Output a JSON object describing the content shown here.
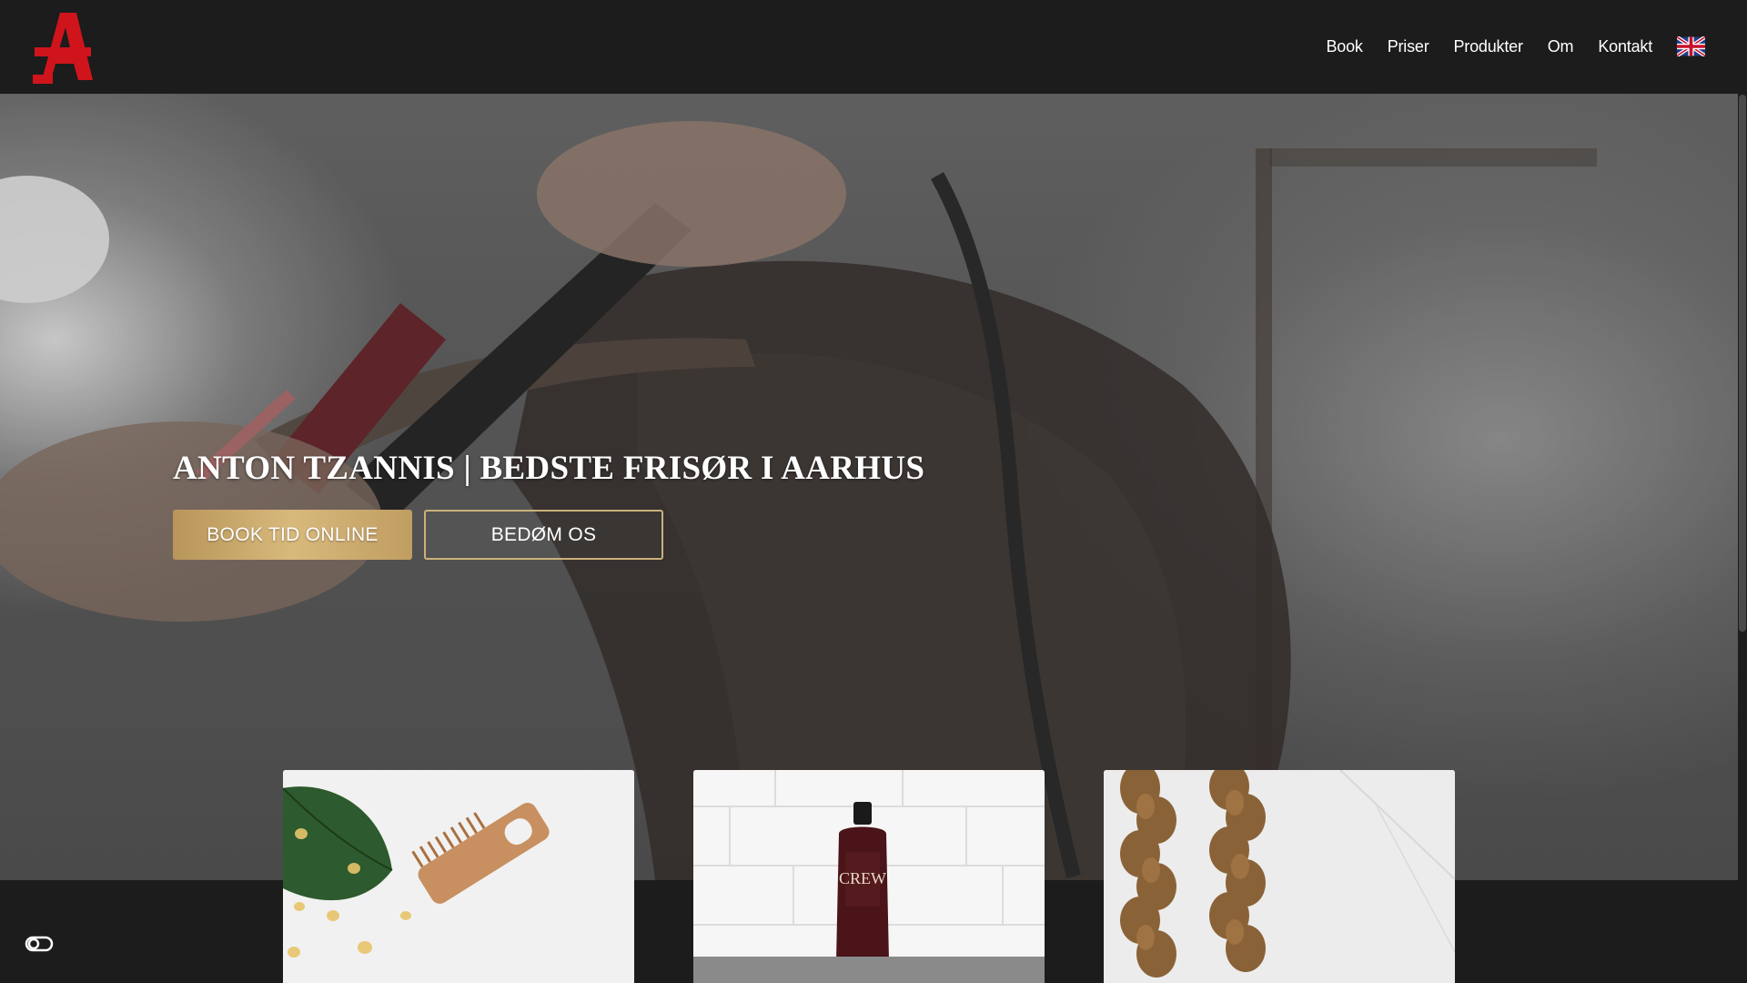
{
  "header": {
    "logo_icon": "red-letter-a-logo",
    "nav": [
      {
        "label": "Book"
      },
      {
        "label": "Priser"
      },
      {
        "label": "Produkter"
      },
      {
        "label": "Om"
      },
      {
        "label": "Kontakt"
      }
    ],
    "language_icon": "uk-flag-icon"
  },
  "hero": {
    "title": "ANTON TZANNIS | BEDSTE FRISØR I AARHUS",
    "primary_button": "BOOK TID ONLINE",
    "secondary_button": "BEDØM OS"
  },
  "accessibility": {
    "icon": "accessibility-toggle-icon"
  },
  "colors": {
    "header_bg": "#1c1c1c",
    "logo_red": "#d0141c",
    "gold_start": "#b8955a",
    "gold_mid": "#d8b97c",
    "gold_border": "#cbb07a"
  }
}
